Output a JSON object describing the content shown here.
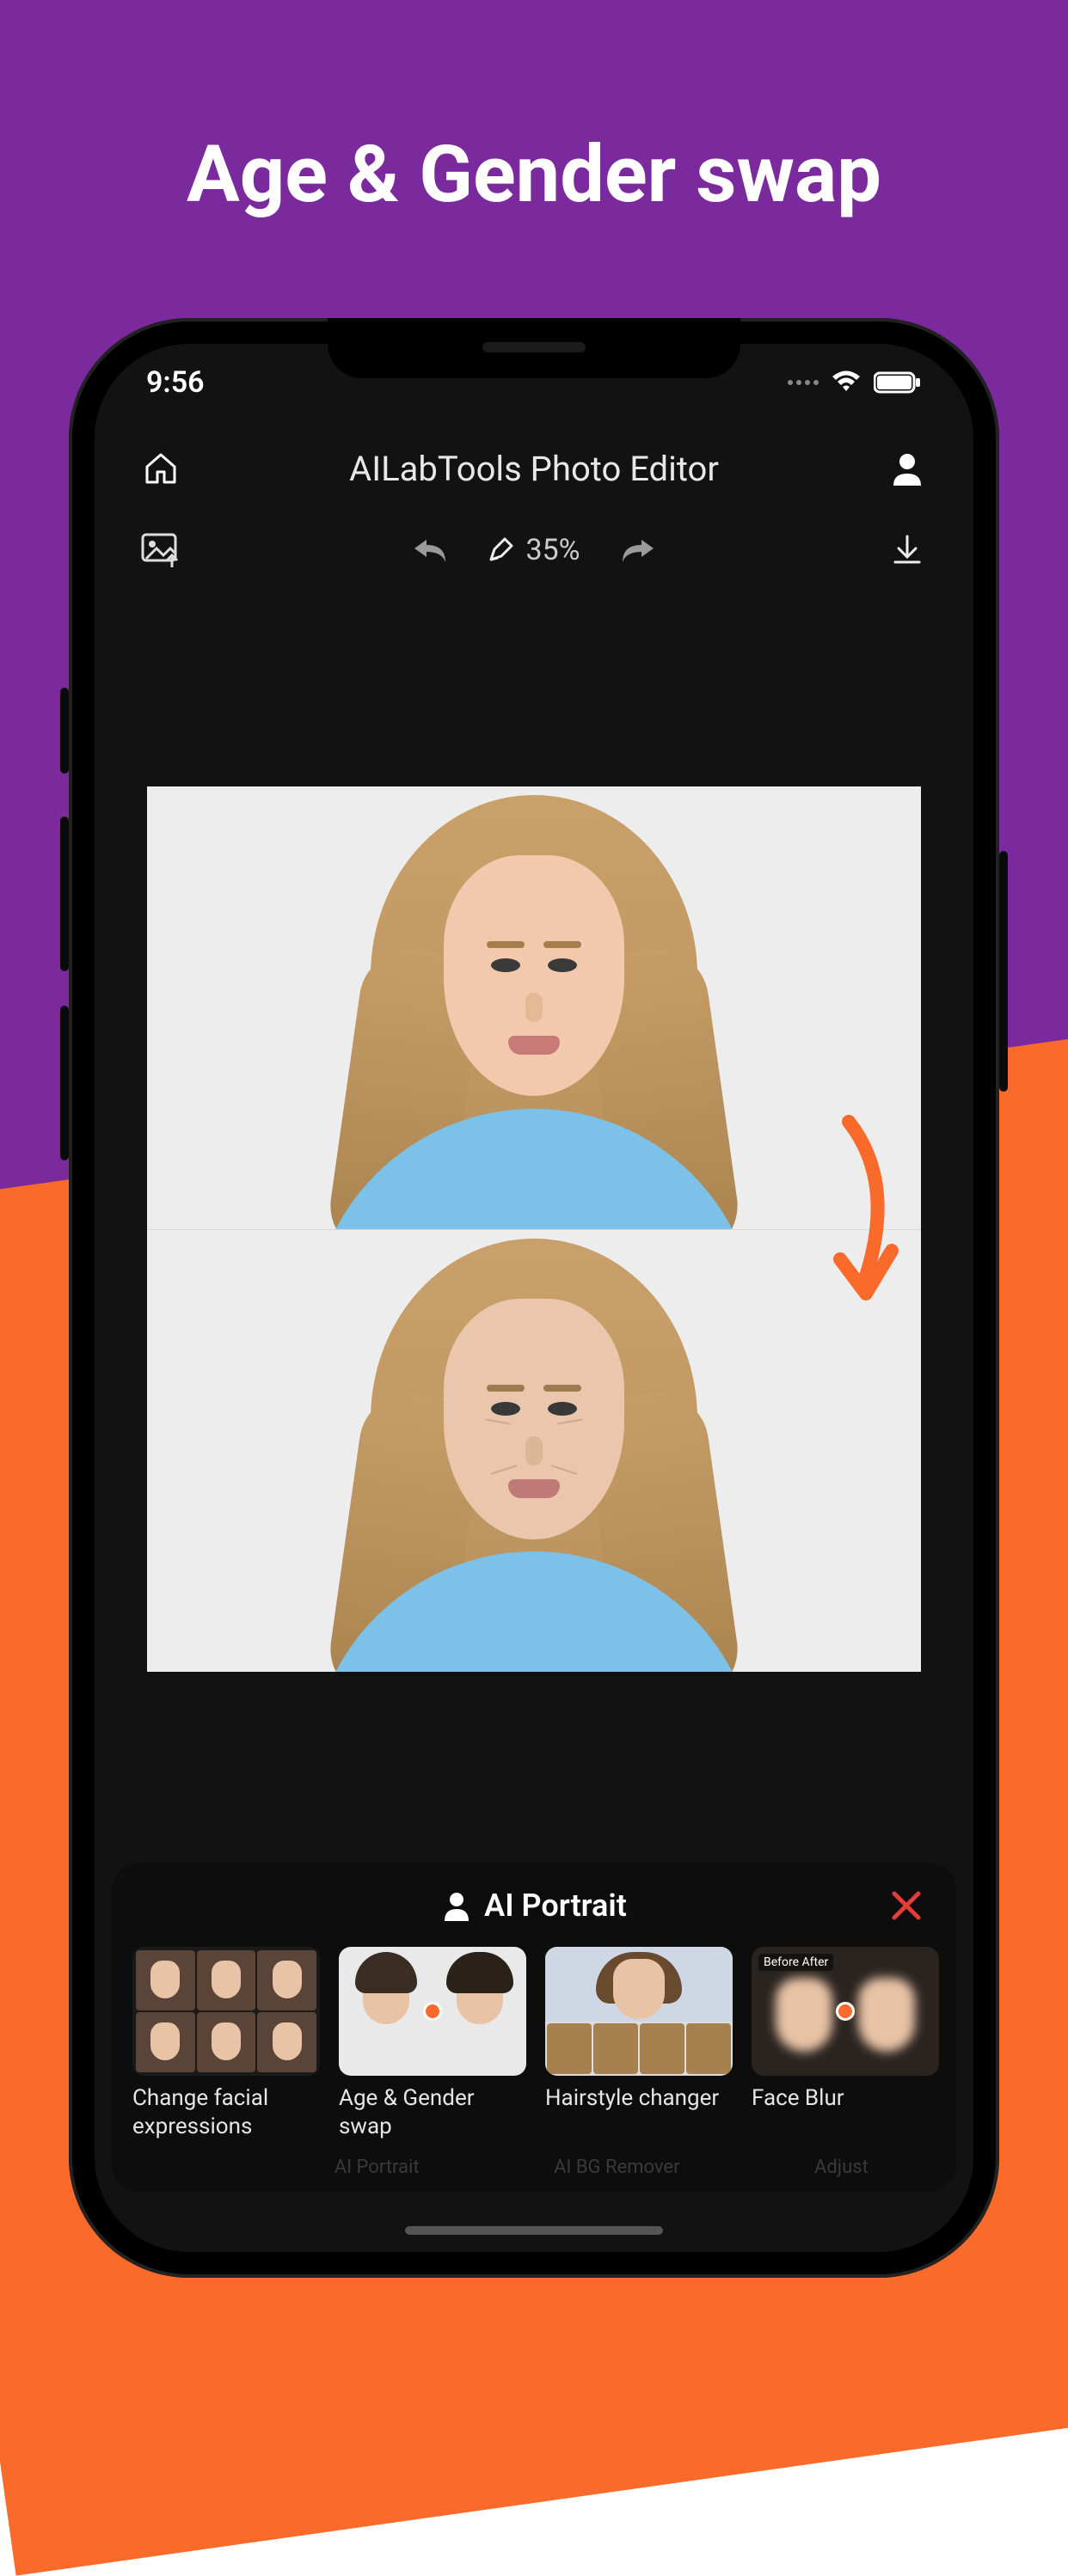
{
  "promo": {
    "title": "Age & Gender swap"
  },
  "status": {
    "time": "9:56"
  },
  "header": {
    "title": "AILabTools Photo Editor"
  },
  "toolbar": {
    "zoom": "35%"
  },
  "panel": {
    "title": "AI Portrait",
    "options": [
      {
        "label": "Change facial expressions"
      },
      {
        "label": "Age & Gender swap"
      },
      {
        "label": "Hairstyle changer"
      },
      {
        "label": "Face Blur"
      }
    ]
  },
  "faint_tabs": [
    "",
    "AI Portrait",
    "AI BG Remover",
    "Adjust"
  ],
  "thumb4_tag": "Before   After",
  "colors": {
    "purple": "#7b2a9e",
    "orange": "#f96a2b",
    "close_red": "#e43b3b"
  }
}
